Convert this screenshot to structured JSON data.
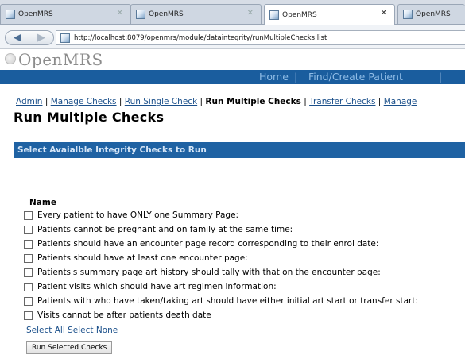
{
  "browser": {
    "tabs": [
      {
        "title": "OpenMRS",
        "active": false
      },
      {
        "title": "OpenMRS",
        "active": false
      },
      {
        "title": "OpenMRS",
        "active": true
      },
      {
        "title": "OpenMRS",
        "active": false
      }
    ],
    "url": "http://localhost:8079/openmrs/module/dataintegrity/runMultipleChecks.list"
  },
  "header": {
    "logo_text": "OpenMRS",
    "nav": {
      "home": "Home",
      "separator": "|",
      "find_patient": "Find/Create Patient"
    }
  },
  "subnav": {
    "items": [
      "Admin",
      "Manage Checks",
      "Run Single Check",
      "Run Multiple Checks",
      "Transfer Checks",
      "Manage"
    ],
    "separator": "|",
    "active": "Run Multiple Checks"
  },
  "page": {
    "title": "Run Multiple Checks",
    "box_header": "Select Avaialble Integrity Checks to Run",
    "column_header": "Name",
    "checks": [
      {
        "label": "Every patient to have ONLY one Summary Page:",
        "checked": false
      },
      {
        "label": "Patients cannot be pregnant and on family at the same time:",
        "checked": false
      },
      {
        "label": "Patients should have an encounter page record corresponding to their enrol date:",
        "checked": false
      },
      {
        "label": "Patients should have at least one encounter page:",
        "checked": false
      },
      {
        "label": "Patients's summary page art history should tally with that on the encounter page:",
        "checked": false
      },
      {
        "label": "Patient visits which should have art regimen information:",
        "checked": false
      },
      {
        "label": "Patients with who have taken/taking art should have either initial art start or transfer start:",
        "checked": false
      },
      {
        "label": "Visits cannot be after patients death date",
        "checked": false
      }
    ],
    "select_all": "Select All",
    "select_none": "Select None",
    "run_button": "Run Selected Checks"
  }
}
